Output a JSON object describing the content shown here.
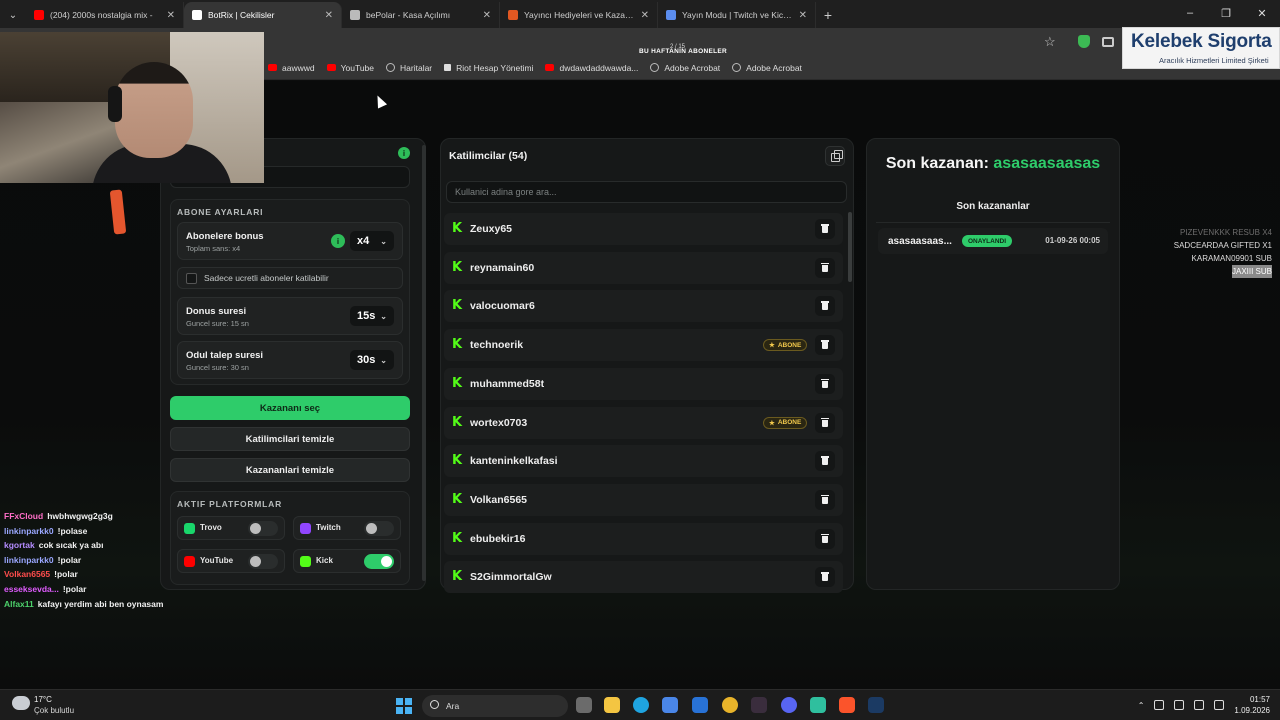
{
  "browser": {
    "tabs": [
      {
        "title": "(204) 2000s nostalgia mix -",
        "color": "#ff0000",
        "active": false
      },
      {
        "title": "BotRix | Cekilisler",
        "color": "#ffffff",
        "active": true
      },
      {
        "title": "bePolar - Kasa Açılımı",
        "color": "#bbbbbb",
        "active": false
      },
      {
        "title": "Yayıncı Hediyeleri ve Kazananla",
        "color": "#e25822",
        "active": false
      },
      {
        "title": "Yayın Modu | Twitch ve Kick ile",
        "color": "#5b8def",
        "active": false
      }
    ],
    "bookmarks": [
      {
        "label": "aawwwd",
        "icon": "youtube-icon"
      },
      {
        "label": "YouTube",
        "icon": "youtube-icon"
      },
      {
        "label": "Haritalar",
        "icon": "globe-icon"
      },
      {
        "label": "Riot Hesap Yönetimi",
        "icon": "riot-icon"
      },
      {
        "label": "dwdawdaddwawda...",
        "icon": "youtube-icon"
      },
      {
        "label": "Adobe Acrobat",
        "icon": "globe-icon"
      },
      {
        "label": "Adobe Acrobat",
        "icon": "globe-icon"
      }
    ],
    "weekly_subs_title": "BU HAFTANIN ABONELER",
    "weekly_subs_count": "2 / 15"
  },
  "settings": {
    "sub_section_title": "ABONE AYARLARI",
    "bonus_label": "Abonelere bonus",
    "bonus_sub": "Toplam sans: x4",
    "bonus_value": "x4",
    "only_paid_label": "Sadece ucretli aboneler katilabilir",
    "duration_label": "Donus suresi",
    "duration_sub": "Guncel sure: 15 sn",
    "duration_value": "15s",
    "claim_label": "Odul talep suresi",
    "claim_sub": "Guncel sure: 30 sn",
    "claim_value": "30s",
    "pick_winner": "Kazananı seç",
    "clear_participants": "Katilimcilari temizle",
    "clear_winners": "Kazananlari temizle",
    "platforms_title": "AKTIF PLATFORMLAR",
    "platforms": [
      {
        "name": "Trovo",
        "color": "#19d66b",
        "on": false
      },
      {
        "name": "Twitch",
        "color": "#9146ff",
        "on": false
      },
      {
        "name": "YouTube",
        "color": "#ff0000",
        "on": false
      },
      {
        "name": "Kick",
        "color": "#53fc18",
        "on": true
      }
    ]
  },
  "participants": {
    "title": "Katilimcilar (54)",
    "search_placeholder": "Kullanici adina gore ara...",
    "badge_label": "ABONE",
    "list": [
      {
        "name": "Zeuxy65",
        "sub": false
      },
      {
        "name": "reynamain60",
        "sub": false
      },
      {
        "name": "valocuomar6",
        "sub": false
      },
      {
        "name": "technoerik",
        "sub": true
      },
      {
        "name": "muhammed58t",
        "sub": false
      },
      {
        "name": "wortex0703",
        "sub": true
      },
      {
        "name": "kanteninkelkafasi",
        "sub": false
      },
      {
        "name": "Volkan6565",
        "sub": false
      },
      {
        "name": "ebubekir16",
        "sub": false
      },
      {
        "name": "S2GimmortalGw",
        "sub": false
      }
    ]
  },
  "winners": {
    "last_winner_prefix": "Son kazanan:",
    "last_winner_name": "asasaasaasas",
    "recent_title": "Son kazananlar",
    "rows": [
      {
        "name": "asasaasaas...",
        "status": "ONAYLANDI",
        "datetime": "01-09-26 00:05"
      }
    ]
  },
  "overlay": {
    "logo_main": "Kelebek Sigorta",
    "logo_sub": "Aracılık Hizmetleri Limited Şirketi",
    "sub_feed": [
      {
        "text": "PIZEVENKKK RESUB X4",
        "style": "faded"
      },
      {
        "text": "SADCEARDAA GIFTED X1",
        "style": "normal"
      },
      {
        "text": "KARAMAN09901 SUB",
        "style": "normal"
      },
      {
        "text": "JAXIII SUB",
        "style": "hl"
      }
    ],
    "chat": [
      {
        "user": "FFxCloud",
        "color": "#ff6ec7",
        "text": "hwbhwgwg2g3g"
      },
      {
        "user": "linkinparkk0",
        "color": "#9aa7ff",
        "text": "!polase"
      },
      {
        "user": "kgortak",
        "color": "#b48cff",
        "text": "cok sıcak ya abı"
      },
      {
        "user": "linkinparkk0",
        "color": "#9aa7ff",
        "text": "!polar"
      },
      {
        "user": "Volkan6565",
        "color": "#ff4d4d",
        "text": "!polar"
      },
      {
        "user": "esseksevda...",
        "color": "#e05cff",
        "text": "!polar"
      },
      {
        "user": "Alfax11",
        "color": "#4dd26b",
        "text": "kafayı yerdim abi ben oynasam"
      }
    ]
  },
  "taskbar": {
    "temp": "17°C",
    "weather": "Çok bulutlu",
    "search": "Ara",
    "time": "01:57",
    "date": "1.09.2026"
  }
}
